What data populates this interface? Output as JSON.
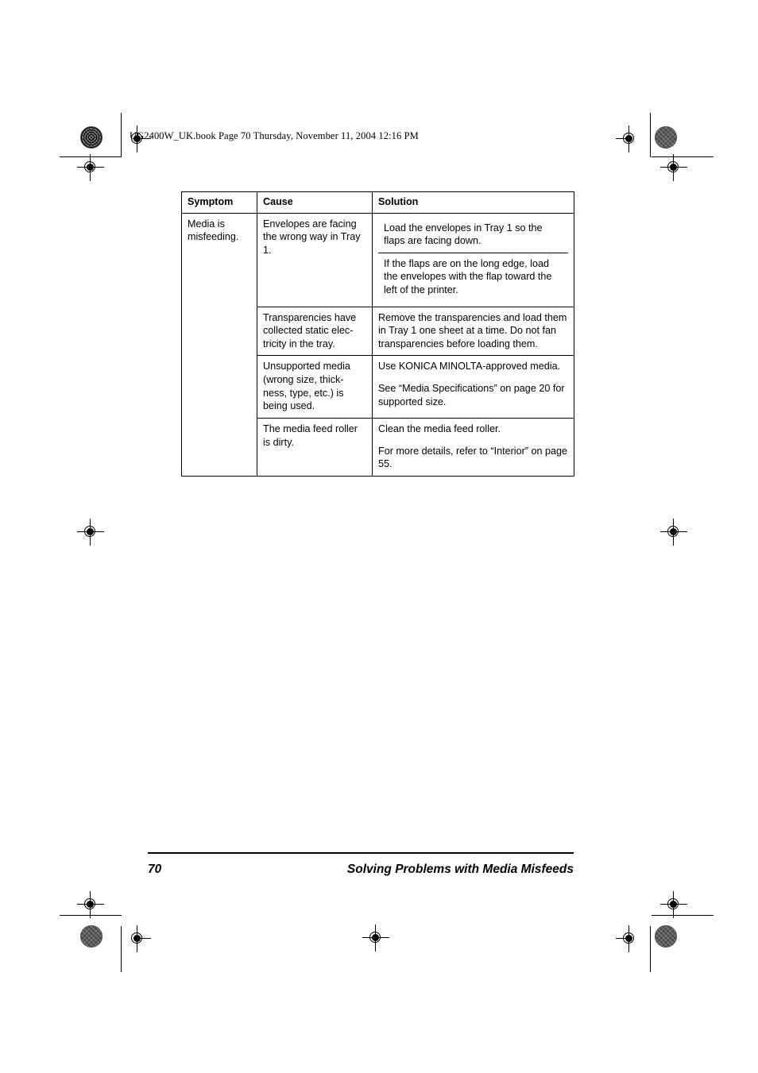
{
  "document": {
    "file_header": "UG2400W_UK.book  Page 70  Thursday, November 11, 2004  12:16 PM"
  },
  "table": {
    "headers": {
      "symptom": "Symptom",
      "cause": "Cause",
      "solution": "Solution"
    },
    "symptom": "Media is misfeeding.",
    "rows": [
      {
        "cause": "Envelopes are facing the wrong way in Tray 1.",
        "solutions": [
          "Load the envelopes in Tray 1 so the flaps are facing down.",
          "If the flaps are on the long edge, load the envelopes with the flap toward the left of the printer."
        ]
      },
      {
        "cause": "Transparencies have collected static elec-tricity in the tray.",
        "solutions": [
          "Remove the transparencies and load them in Tray 1 one sheet at a time. Do not fan transparencies before loading them."
        ]
      },
      {
        "cause": "Unsupported media (wrong size, thick-ness, type, etc.) is being used.",
        "solution_paragraphs": [
          "Use KONICA MINOLTA-approved media.",
          "See “Media Specifications” on page 20 for supported size."
        ]
      },
      {
        "cause": "The media feed roller is dirty.",
        "solution_paragraphs": [
          "Clean the media feed roller.",
          "For more details, refer to “Interior” on page 55."
        ]
      }
    ]
  },
  "footer": {
    "page_number": "70",
    "title": "Solving Problems with Media Misfeeds"
  },
  "colors": {
    "ink": "#000000",
    "paper": "#ffffff",
    "mark_gray": "#7d7d7d"
  }
}
